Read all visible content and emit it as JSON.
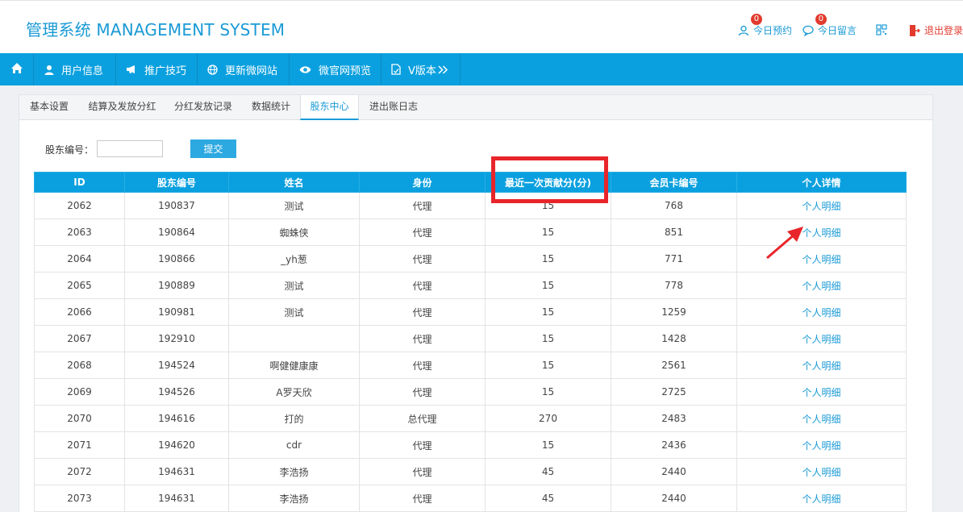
{
  "header": {
    "title": "管理系统 MANAGEMENT SYSTEM",
    "appointments_label": "今日预约",
    "appointments_count": "0",
    "messages_label": "今日留言",
    "messages_count": "0",
    "logout_label": "退出登录"
  },
  "nav": {
    "items": [
      {
        "label": ""
      },
      {
        "label": "用户信息"
      },
      {
        "label": "推广技巧"
      },
      {
        "label": "更新微网站"
      },
      {
        "label": "微官网预览"
      },
      {
        "label": "V版本"
      }
    ]
  },
  "tabs": [
    "基本设置",
    "结算及发放分红",
    "分红发放记录",
    "数据统计",
    "股东中心",
    "进出账日志"
  ],
  "active_tab": "股东中心",
  "search": {
    "label": "股东编号：",
    "value": "",
    "button": "提交"
  },
  "table": {
    "headers": [
      "ID",
      "股东编号",
      "姓名",
      "身份",
      "最近一次贡献分(分)",
      "会员卡编号",
      "个人详情"
    ],
    "rows": [
      [
        "2062",
        "190837",
        "测试",
        "代理",
        "15",
        "768",
        "个人明细"
      ],
      [
        "2063",
        "190864",
        "蜘蛛侠",
        "代理",
        "15",
        "851",
        "个人明细"
      ],
      [
        "2064",
        "190866",
        "_yh葱",
        "代理",
        "15",
        "771",
        "个人明细"
      ],
      [
        "2065",
        "190889",
        "测试",
        "代理",
        "15",
        "778",
        "个人明细"
      ],
      [
        "2066",
        "190981",
        "测试",
        "代理",
        "15",
        "1259",
        "个人明细"
      ],
      [
        "2067",
        "192910",
        "",
        "代理",
        "15",
        "1428",
        "个人明细"
      ],
      [
        "2068",
        "194524",
        "啊健健康康",
        "代理",
        "15",
        "2561",
        "个人明细"
      ],
      [
        "2069",
        "194526",
        "A罗天欣",
        "代理",
        "15",
        "2725",
        "个人明细"
      ],
      [
        "2070",
        "194616",
        "打的",
        "总代理",
        "270",
        "2483",
        "个人明细"
      ],
      [
        "2071",
        "194620",
        "cdr",
        "代理",
        "15",
        "2436",
        "个人明细"
      ],
      [
        "2072",
        "194631",
        "李浩扬",
        "代理",
        "45",
        "2440",
        "个人明细"
      ],
      [
        "2073",
        "194631",
        "李浩扬",
        "代理",
        "45",
        "2440",
        "个人明细"
      ]
    ]
  },
  "colors": {
    "accent": "#0aa0df",
    "link": "#1a9ad6",
    "annotation": "#e8252a"
  }
}
